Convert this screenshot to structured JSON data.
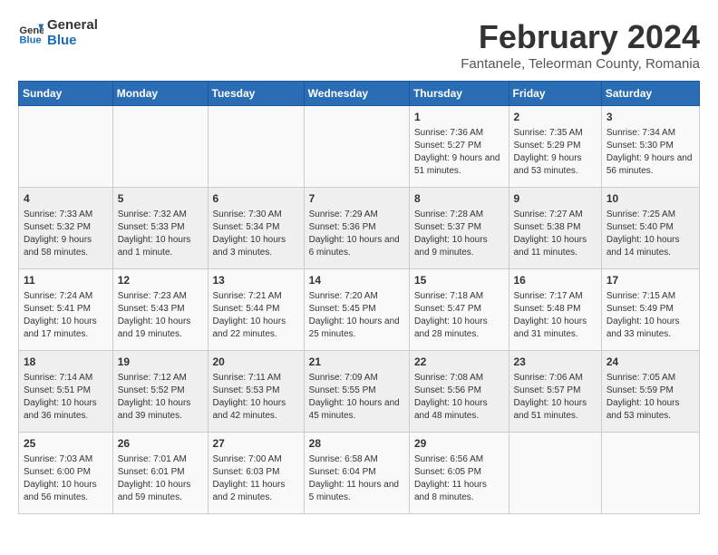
{
  "header": {
    "logo_general": "General",
    "logo_blue": "Blue",
    "title": "February 2024",
    "subtitle": "Fantanele, Teleorman County, Romania"
  },
  "days_of_week": [
    "Sunday",
    "Monday",
    "Tuesday",
    "Wednesday",
    "Thursday",
    "Friday",
    "Saturday"
  ],
  "weeks": [
    [
      {
        "day": "",
        "content": ""
      },
      {
        "day": "",
        "content": ""
      },
      {
        "day": "",
        "content": ""
      },
      {
        "day": "",
        "content": ""
      },
      {
        "day": "1",
        "content": "Sunrise: 7:36 AM\nSunset: 5:27 PM\nDaylight: 9 hours and 51 minutes."
      },
      {
        "day": "2",
        "content": "Sunrise: 7:35 AM\nSunset: 5:29 PM\nDaylight: 9 hours and 53 minutes."
      },
      {
        "day": "3",
        "content": "Sunrise: 7:34 AM\nSunset: 5:30 PM\nDaylight: 9 hours and 56 minutes."
      }
    ],
    [
      {
        "day": "4",
        "content": "Sunrise: 7:33 AM\nSunset: 5:32 PM\nDaylight: 9 hours and 58 minutes."
      },
      {
        "day": "5",
        "content": "Sunrise: 7:32 AM\nSunset: 5:33 PM\nDaylight: 10 hours and 1 minute."
      },
      {
        "day": "6",
        "content": "Sunrise: 7:30 AM\nSunset: 5:34 PM\nDaylight: 10 hours and 3 minutes."
      },
      {
        "day": "7",
        "content": "Sunrise: 7:29 AM\nSunset: 5:36 PM\nDaylight: 10 hours and 6 minutes."
      },
      {
        "day": "8",
        "content": "Sunrise: 7:28 AM\nSunset: 5:37 PM\nDaylight: 10 hours and 9 minutes."
      },
      {
        "day": "9",
        "content": "Sunrise: 7:27 AM\nSunset: 5:38 PM\nDaylight: 10 hours and 11 minutes."
      },
      {
        "day": "10",
        "content": "Sunrise: 7:25 AM\nSunset: 5:40 PM\nDaylight: 10 hours and 14 minutes."
      }
    ],
    [
      {
        "day": "11",
        "content": "Sunrise: 7:24 AM\nSunset: 5:41 PM\nDaylight: 10 hours and 17 minutes."
      },
      {
        "day": "12",
        "content": "Sunrise: 7:23 AM\nSunset: 5:43 PM\nDaylight: 10 hours and 19 minutes."
      },
      {
        "day": "13",
        "content": "Sunrise: 7:21 AM\nSunset: 5:44 PM\nDaylight: 10 hours and 22 minutes."
      },
      {
        "day": "14",
        "content": "Sunrise: 7:20 AM\nSunset: 5:45 PM\nDaylight: 10 hours and 25 minutes."
      },
      {
        "day": "15",
        "content": "Sunrise: 7:18 AM\nSunset: 5:47 PM\nDaylight: 10 hours and 28 minutes."
      },
      {
        "day": "16",
        "content": "Sunrise: 7:17 AM\nSunset: 5:48 PM\nDaylight: 10 hours and 31 minutes."
      },
      {
        "day": "17",
        "content": "Sunrise: 7:15 AM\nSunset: 5:49 PM\nDaylight: 10 hours and 33 minutes."
      }
    ],
    [
      {
        "day": "18",
        "content": "Sunrise: 7:14 AM\nSunset: 5:51 PM\nDaylight: 10 hours and 36 minutes."
      },
      {
        "day": "19",
        "content": "Sunrise: 7:12 AM\nSunset: 5:52 PM\nDaylight: 10 hours and 39 minutes."
      },
      {
        "day": "20",
        "content": "Sunrise: 7:11 AM\nSunset: 5:53 PM\nDaylight: 10 hours and 42 minutes."
      },
      {
        "day": "21",
        "content": "Sunrise: 7:09 AM\nSunset: 5:55 PM\nDaylight: 10 hours and 45 minutes."
      },
      {
        "day": "22",
        "content": "Sunrise: 7:08 AM\nSunset: 5:56 PM\nDaylight: 10 hours and 48 minutes."
      },
      {
        "day": "23",
        "content": "Sunrise: 7:06 AM\nSunset: 5:57 PM\nDaylight: 10 hours and 51 minutes."
      },
      {
        "day": "24",
        "content": "Sunrise: 7:05 AM\nSunset: 5:59 PM\nDaylight: 10 hours and 53 minutes."
      }
    ],
    [
      {
        "day": "25",
        "content": "Sunrise: 7:03 AM\nSunset: 6:00 PM\nDaylight: 10 hours and 56 minutes."
      },
      {
        "day": "26",
        "content": "Sunrise: 7:01 AM\nSunset: 6:01 PM\nDaylight: 10 hours and 59 minutes."
      },
      {
        "day": "27",
        "content": "Sunrise: 7:00 AM\nSunset: 6:03 PM\nDaylight: 11 hours and 2 minutes."
      },
      {
        "day": "28",
        "content": "Sunrise: 6:58 AM\nSunset: 6:04 PM\nDaylight: 11 hours and 5 minutes."
      },
      {
        "day": "29",
        "content": "Sunrise: 6:56 AM\nSunset: 6:05 PM\nDaylight: 11 hours and 8 minutes."
      },
      {
        "day": "",
        "content": ""
      },
      {
        "day": "",
        "content": ""
      }
    ]
  ]
}
